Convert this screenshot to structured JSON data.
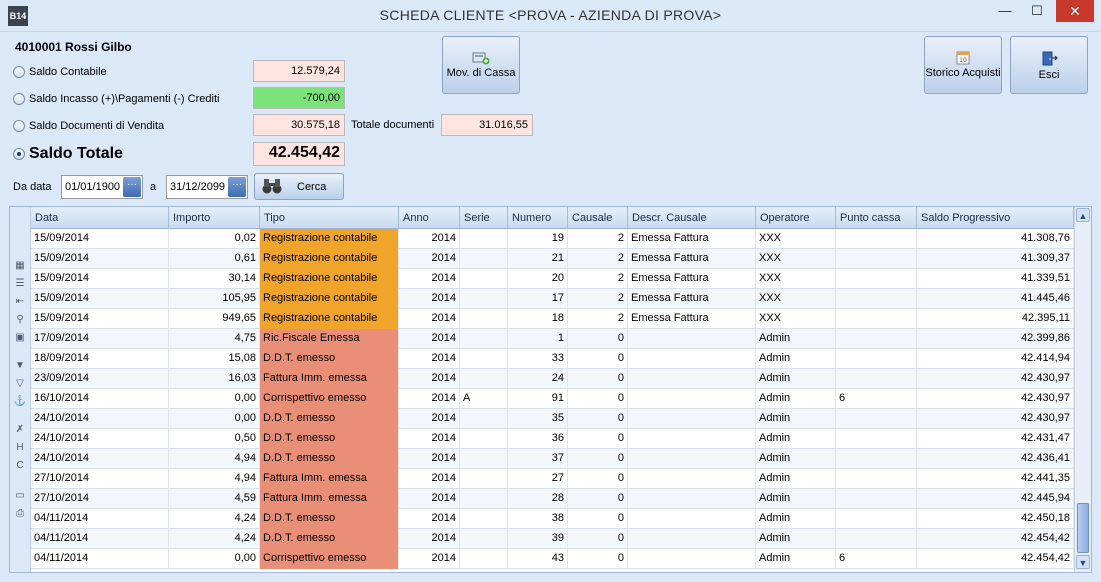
{
  "window": {
    "title": "SCHEDA CLIENTE <PROVA - AZIENDA DI PROVA>",
    "app_icon_label": "B14",
    "min_label": "—",
    "max_label": "☐",
    "close_label": "✕"
  },
  "customer": {
    "name": "4010001 Rossi Gilbo"
  },
  "balances": {
    "saldo_contabile": {
      "label": "Saldo Contabile",
      "value": "12.579,24"
    },
    "saldo_incasso": {
      "label": "Saldo Incasso (+)\\Pagamenti (-) Crediti",
      "value": "-700,00"
    },
    "saldo_documenti": {
      "label": "Saldo Documenti di Vendita",
      "value": "30.575,18"
    },
    "totale_documenti": {
      "label": "Totale documenti",
      "value": "31.016,55"
    },
    "saldo_totale": {
      "label": "Saldo Totale",
      "value": "42.454,42"
    }
  },
  "buttons": {
    "mov_cassa": "Mov. di Cassa",
    "storico_acquisti": "Storico Acquisti",
    "esci": "Esci",
    "cerca": "Cerca"
  },
  "filter": {
    "da_data_label": "Da data",
    "da_data_value": "01/01/1900",
    "a_label": "a",
    "a_value": "31/12/2099",
    "dropdown_glyph": "···"
  },
  "grid": {
    "columns": [
      "Data",
      "Importo",
      "Tipo",
      "Anno",
      "Serie",
      "Numero",
      "Causale",
      "Descr. Causale",
      "Operatore",
      "Punto cassa",
      "Saldo Progressivo"
    ],
    "rows": [
      {
        "data": "15/09/2014",
        "importo": "0,02",
        "tipo": "Registrazione contabile",
        "anno": "2014",
        "serie": "",
        "numero": "19",
        "causale": "2",
        "descr": "Emessa Fattura",
        "operatore": "XXX",
        "punto": "",
        "saldo": "41.308,76"
      },
      {
        "data": "15/09/2014",
        "importo": "0,61",
        "tipo": "Registrazione contabile",
        "anno": "2014",
        "serie": "",
        "numero": "21",
        "causale": "2",
        "descr": "Emessa Fattura",
        "operatore": "XXX",
        "punto": "",
        "saldo": "41.309,37"
      },
      {
        "data": "15/09/2014",
        "importo": "30,14",
        "tipo": "Registrazione contabile",
        "anno": "2014",
        "serie": "",
        "numero": "20",
        "causale": "2",
        "descr": "Emessa Fattura",
        "operatore": "XXX",
        "punto": "",
        "saldo": "41.339,51"
      },
      {
        "data": "15/09/2014",
        "importo": "105,95",
        "tipo": "Registrazione contabile",
        "anno": "2014",
        "serie": "",
        "numero": "17",
        "causale": "2",
        "descr": "Emessa Fattura",
        "operatore": "XXX",
        "punto": "",
        "saldo": "41.445,46"
      },
      {
        "data": "15/09/2014",
        "importo": "949,65",
        "tipo": "Registrazione contabile",
        "anno": "2014",
        "serie": "",
        "numero": "18",
        "causale": "2",
        "descr": "Emessa Fattura",
        "operatore": "XXX",
        "punto": "",
        "saldo": "42.395,11"
      },
      {
        "data": "17/09/2014",
        "importo": "4,75",
        "tipo": "Ric.Fiscale Emessa",
        "anno": "2014",
        "serie": "",
        "numero": "1",
        "causale": "0",
        "descr": "",
        "operatore": "Admin",
        "punto": "",
        "saldo": "42.399,86"
      },
      {
        "data": "18/09/2014",
        "importo": "15,08",
        "tipo": "D.D.T. emesso",
        "anno": "2014",
        "serie": "",
        "numero": "33",
        "causale": "0",
        "descr": "",
        "operatore": "Admin",
        "punto": "",
        "saldo": "42.414,94"
      },
      {
        "data": "23/09/2014",
        "importo": "16,03",
        "tipo": "Fattura Imm. emessa",
        "anno": "2014",
        "serie": "",
        "numero": "24",
        "causale": "0",
        "descr": "",
        "operatore": "Admin",
        "punto": "",
        "saldo": "42.430,97"
      },
      {
        "data": "16/10/2014",
        "importo": "0,00",
        "tipo": "Corrispettivo emesso",
        "anno": "2014",
        "serie": "A",
        "numero": "91",
        "causale": "0",
        "descr": "",
        "operatore": "Admin",
        "punto": "6",
        "saldo": "42.430,97"
      },
      {
        "data": "24/10/2014",
        "importo": "0,00",
        "tipo": "D.D.T. emesso",
        "anno": "2014",
        "serie": "",
        "numero": "35",
        "causale": "0",
        "descr": "",
        "operatore": "Admin",
        "punto": "",
        "saldo": "42.430,97"
      },
      {
        "data": "24/10/2014",
        "importo": "0,50",
        "tipo": "D.D.T. emesso",
        "anno": "2014",
        "serie": "",
        "numero": "36",
        "causale": "0",
        "descr": "",
        "operatore": "Admin",
        "punto": "",
        "saldo": "42.431,47"
      },
      {
        "data": "24/10/2014",
        "importo": "4,94",
        "tipo": "D.D.T. emesso",
        "anno": "2014",
        "serie": "",
        "numero": "37",
        "causale": "0",
        "descr": "",
        "operatore": "Admin",
        "punto": "",
        "saldo": "42.436,41"
      },
      {
        "data": "27/10/2014",
        "importo": "4,94",
        "tipo": "Fattura Imm. emessa",
        "anno": "2014",
        "serie": "",
        "numero": "27",
        "causale": "0",
        "descr": "",
        "operatore": "Admin",
        "punto": "",
        "saldo": "42.441,35"
      },
      {
        "data": "27/10/2014",
        "importo": "4,59",
        "tipo": "Fattura Imm. emessa",
        "anno": "2014",
        "serie": "",
        "numero": "28",
        "causale": "0",
        "descr": "",
        "operatore": "Admin",
        "punto": "",
        "saldo": "42.445,94"
      },
      {
        "data": "04/11/2014",
        "importo": "4,24",
        "tipo": "D.D.T. emesso",
        "anno": "2014",
        "serie": "",
        "numero": "38",
        "causale": "0",
        "descr": "",
        "operatore": "Admin",
        "punto": "",
        "saldo": "42.450,18"
      },
      {
        "data": "04/11/2014",
        "importo": "4,24",
        "tipo": "D.D.T. emesso",
        "anno": "2014",
        "serie": "",
        "numero": "39",
        "causale": "0",
        "descr": "",
        "operatore": "Admin",
        "punto": "",
        "saldo": "42.454,42"
      },
      {
        "data": "04/11/2014",
        "importo": "0,00",
        "tipo": "Corrispettivo emesso",
        "anno": "2014",
        "serie": "",
        "numero": "43",
        "causale": "0",
        "descr": "",
        "operatore": "Admin",
        "punto": "6",
        "saldo": "42.454,42"
      }
    ]
  },
  "colors": {
    "registrazione_tipo": "#f0a52a",
    "document_tipo": "#e98f77",
    "balance_positive_bg": "#fde4e1",
    "balance_green_bg": "#7ce37a"
  }
}
